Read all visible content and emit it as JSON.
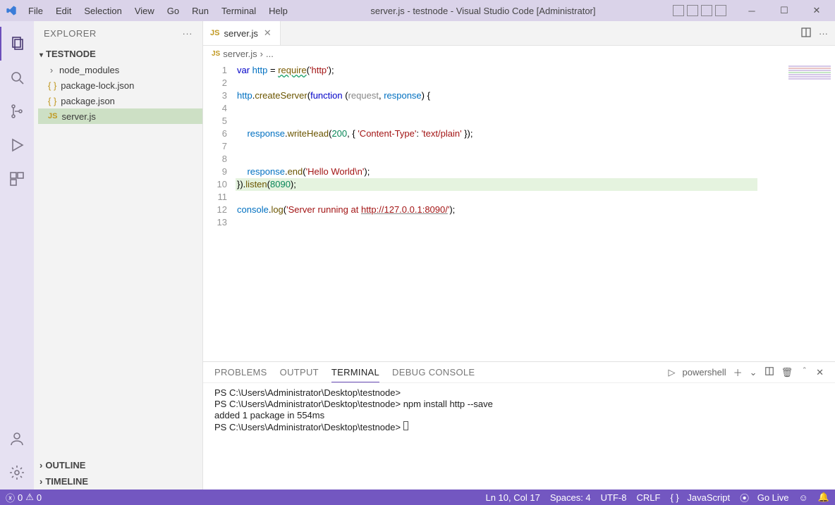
{
  "titlebar": {
    "menus": [
      "File",
      "Edit",
      "Selection",
      "View",
      "Go",
      "Run",
      "Terminal",
      "Help"
    ],
    "title": "server.js - testnode - Visual Studio Code [Administrator]"
  },
  "activitybar": {
    "items": [
      "explorer",
      "search",
      "source-control",
      "run-debug",
      "extensions"
    ],
    "bottom": [
      "accounts",
      "manage"
    ]
  },
  "sidebar": {
    "title": "EXPLORER",
    "folder": "TESTNODE",
    "tree": [
      {
        "label": "node_modules",
        "kind": "folder",
        "expanded": false
      },
      {
        "label": "package-lock.json",
        "kind": "json"
      },
      {
        "label": "package.json",
        "kind": "json"
      },
      {
        "label": "server.js",
        "kind": "js",
        "selected": true
      }
    ],
    "outline": "OUTLINE",
    "timeline": "TIMELINE"
  },
  "tabs": {
    "open": [
      {
        "label": "server.js",
        "icon": "JS"
      }
    ]
  },
  "breadcrumbs": {
    "file": "server.js",
    "rest": "..."
  },
  "editor": {
    "highlight_line": 10,
    "lines": [
      {
        "n": 1,
        "seg": [
          [
            "kw",
            "var "
          ],
          [
            "var",
            "http"
          ],
          [
            "",
            " = "
          ],
          [
            "fn squig",
            "require"
          ],
          [
            "",
            "("
          ],
          [
            "str",
            "'http'"
          ],
          [
            "",
            ");"
          ]
        ]
      },
      {
        "n": 2,
        "seg": [
          [
            "",
            ""
          ]
        ]
      },
      {
        "n": 3,
        "seg": [
          [
            "var",
            "http"
          ],
          [
            "",
            "."
          ],
          [
            "meth",
            "createServer"
          ],
          [
            "",
            "("
          ],
          [
            "kw",
            "function"
          ],
          [
            "",
            " ("
          ],
          [
            "param",
            "request"
          ],
          [
            "",
            ", "
          ],
          [
            "var",
            "response"
          ],
          [
            "",
            ") {"
          ]
        ]
      },
      {
        "n": 4,
        "seg": [
          [
            "",
            ""
          ]
        ]
      },
      {
        "n": 5,
        "seg": [
          [
            "",
            ""
          ]
        ]
      },
      {
        "n": 6,
        "seg": [
          [
            "",
            "    "
          ],
          [
            "var",
            "response"
          ],
          [
            "",
            "."
          ],
          [
            "meth",
            "writeHead"
          ],
          [
            "",
            "("
          ],
          [
            "num",
            "200"
          ],
          [
            "",
            ", { "
          ],
          [
            "str",
            "'Content-Type'"
          ],
          [
            "",
            ": "
          ],
          [
            "str",
            "'text/plain'"
          ],
          [
            "",
            " });"
          ]
        ]
      },
      {
        "n": 7,
        "seg": [
          [
            "",
            ""
          ]
        ]
      },
      {
        "n": 8,
        "seg": [
          [
            "",
            ""
          ]
        ]
      },
      {
        "n": 9,
        "seg": [
          [
            "",
            "    "
          ],
          [
            "var",
            "response"
          ],
          [
            "",
            "."
          ],
          [
            "meth",
            "end"
          ],
          [
            "",
            "("
          ],
          [
            "str",
            "'Hello World\\n'"
          ],
          [
            "",
            ");"
          ]
        ]
      },
      {
        "n": 10,
        "seg": [
          [
            "",
            "})."
          ],
          [
            "meth",
            "listen"
          ],
          [
            "",
            "("
          ],
          [
            "num",
            "8090"
          ],
          [
            "",
            ");"
          ]
        ]
      },
      {
        "n": 11,
        "seg": [
          [
            "",
            ""
          ]
        ]
      },
      {
        "n": 12,
        "seg": [
          [
            "var",
            "console"
          ],
          [
            "",
            "."
          ],
          [
            "meth",
            "log"
          ],
          [
            "",
            "("
          ],
          [
            "str",
            "'Server running at "
          ],
          [
            "link",
            "http://127.0.0.1:8090/"
          ],
          [
            "str",
            "'"
          ],
          [
            "",
            ");"
          ]
        ]
      },
      {
        "n": 13,
        "seg": [
          [
            "",
            ""
          ]
        ]
      }
    ]
  },
  "panel": {
    "tabs": [
      "PROBLEMS",
      "OUTPUT",
      "TERMINAL",
      "DEBUG CONSOLE"
    ],
    "active": "TERMINAL",
    "shell": "powershell",
    "lines": [
      "PS C:\\Users\\Administrator\\Desktop\\testnode>",
      "PS C:\\Users\\Administrator\\Desktop\\testnode> npm install http --save",
      "",
      "added 1 package in 554ms",
      "PS C:\\Users\\Administrator\\Desktop\\testnode>"
    ]
  },
  "statusbar": {
    "errors": "0",
    "warnings": "0",
    "ln_col": "Ln 10, Col 17",
    "spaces": "Spaces: 4",
    "encoding": "UTF-8",
    "eol": "CRLF",
    "lang_icon": "{ }",
    "lang": "JavaScript",
    "golive": "Go Live"
  }
}
